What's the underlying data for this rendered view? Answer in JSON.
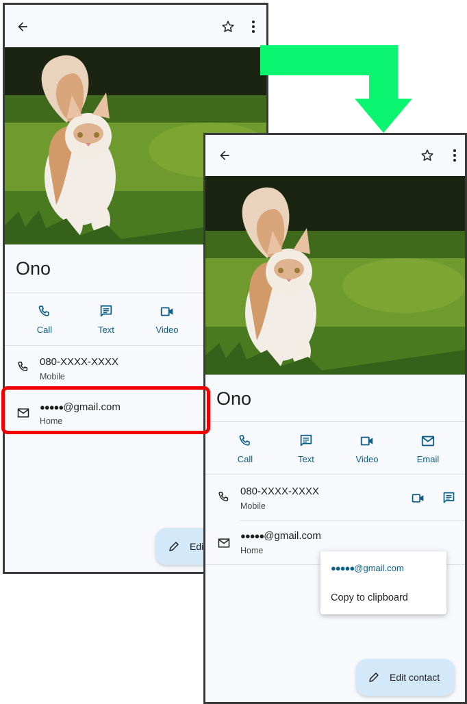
{
  "contact": {
    "name": "Ono",
    "phone": "080-XXXX-XXXX",
    "phone_type": "Mobile",
    "email_dots": "●●●●●",
    "email_domain": "@gmail.com",
    "email_type": "Home"
  },
  "actions": {
    "call": "Call",
    "text": "Text",
    "video": "Video",
    "email": "Email"
  },
  "fab": {
    "label_full": "Edit contact",
    "label_cut": "Edit"
  },
  "popup_menu": {
    "email_dots": "●●●●●",
    "email_domain": "@gmail.com",
    "copy": "Copy to clipboard"
  },
  "colors": {
    "accent": "#0b5e86",
    "highlight": "#f00000",
    "arrow": "#0cf571",
    "fab_bg": "#d3e8f8"
  }
}
